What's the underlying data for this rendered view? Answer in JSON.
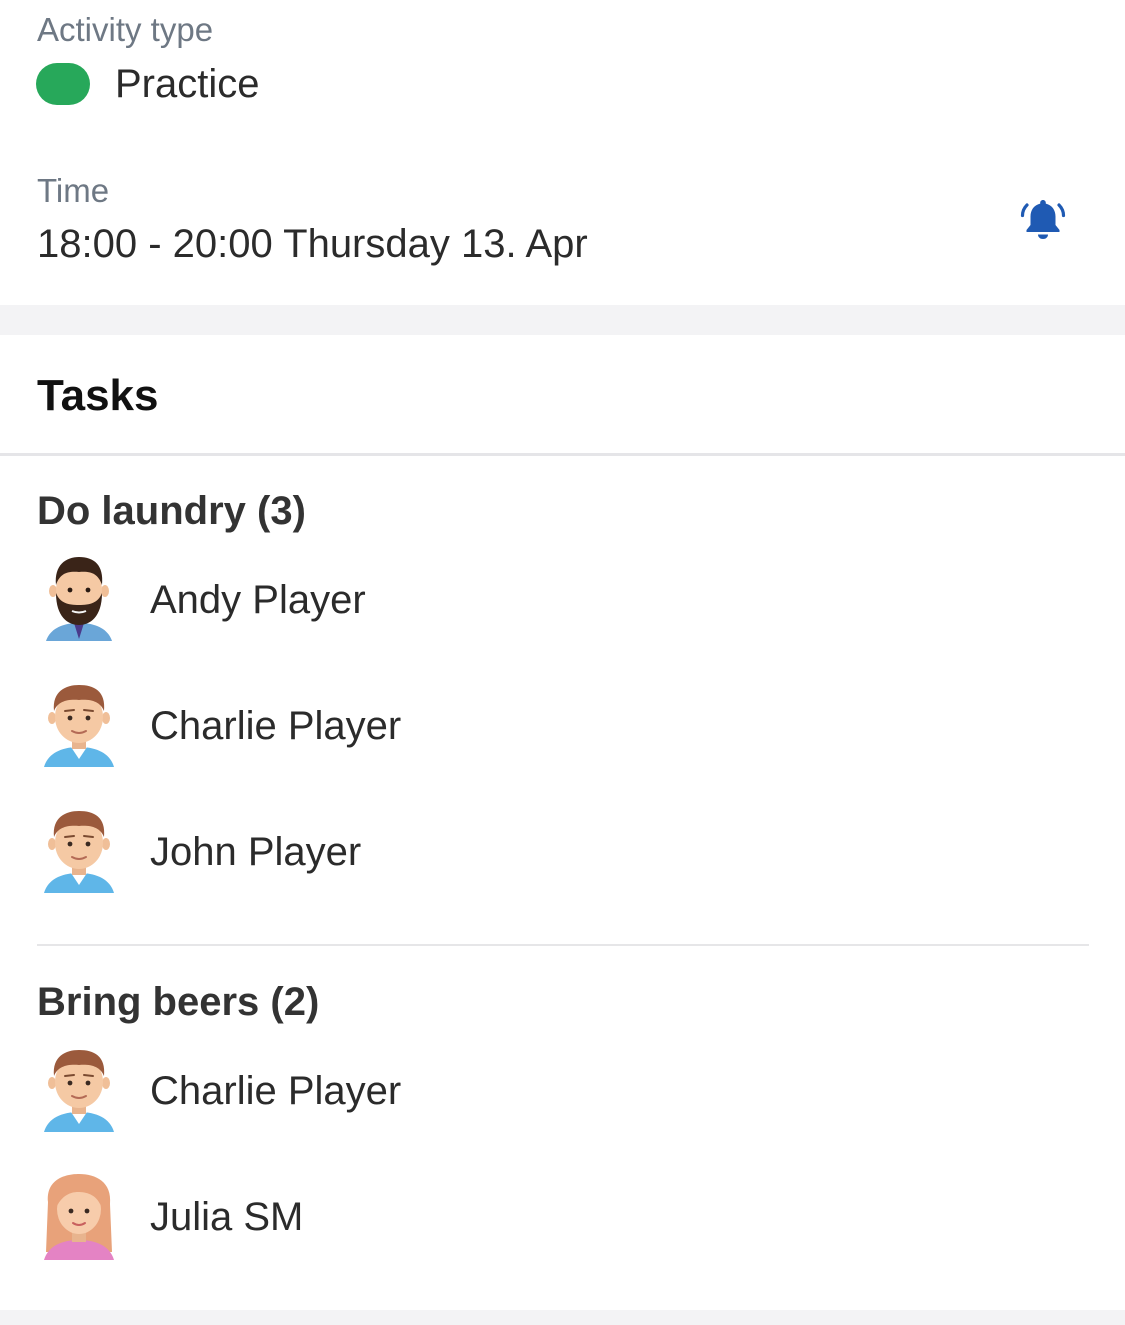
{
  "activity": {
    "label": "Activity type",
    "type": "Practice",
    "type_color": "#27a85a"
  },
  "time": {
    "label": "Time",
    "value": "18:00 - 20:00 Thursday 13. Apr",
    "reminder_icon": "bell-ringing-icon",
    "icon_color": "#1f5ab3"
  },
  "tasks": {
    "header": "Tasks",
    "groups": [
      {
        "title": "Do laundry (3)",
        "members": [
          {
            "name": "Andy Player",
            "avatar": "bearded-man-avatar"
          },
          {
            "name": "Charlie Player",
            "avatar": "man-avatar"
          },
          {
            "name": "John Player",
            "avatar": "man-avatar"
          }
        ]
      },
      {
        "title": "Bring beers (2)",
        "members": [
          {
            "name": "Charlie Player",
            "avatar": "man-avatar"
          },
          {
            "name": "Julia SM",
            "avatar": "woman-avatar"
          }
        ]
      }
    ]
  }
}
